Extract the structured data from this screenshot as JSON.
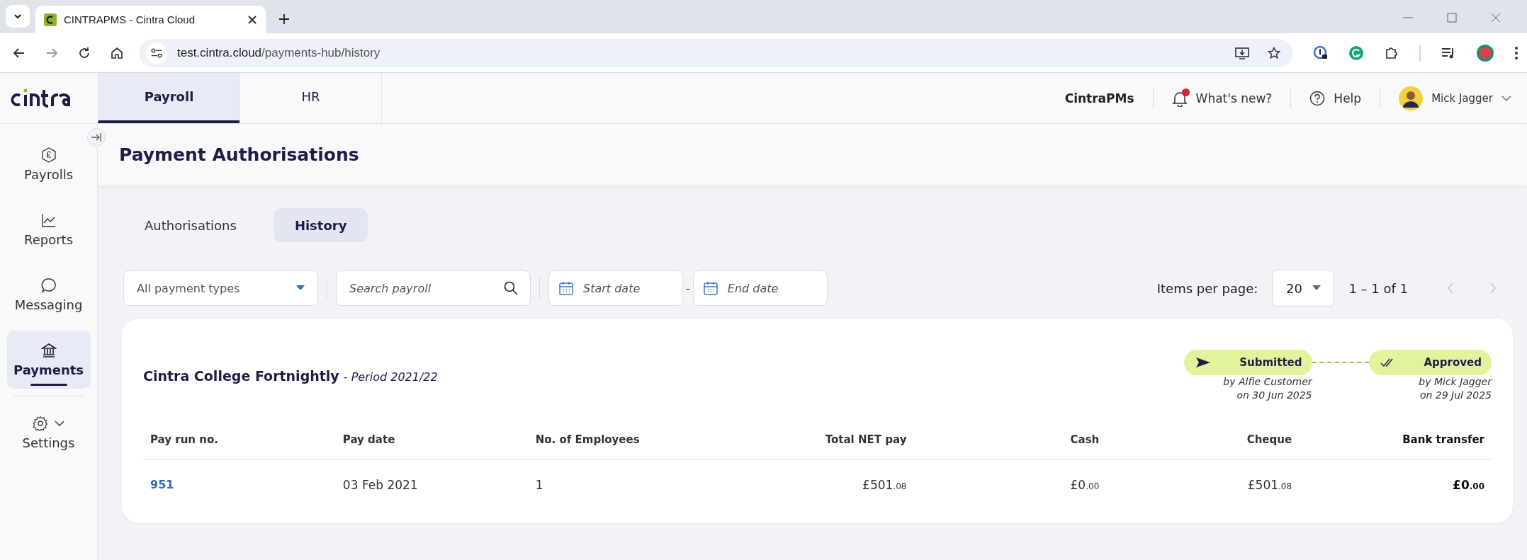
{
  "browser": {
    "tab_title": "CINTRAPMS - Cintra Cloud",
    "url_host": "test.cintra.cloud",
    "url_path": "/payments-hub/history"
  },
  "app_header": {
    "tabs": [
      {
        "label": "Payroll",
        "selected": true
      },
      {
        "label": "HR",
        "selected": false
      }
    ],
    "org": "CintraPMs",
    "whats_new": "What's new?",
    "whats_new_unread": true,
    "help": "Help",
    "user": "Mick Jagger"
  },
  "sidebar": {
    "items": [
      {
        "label": "Payrolls",
        "selected": false
      },
      {
        "label": "Reports",
        "selected": false
      },
      {
        "label": "Messaging",
        "selected": false
      },
      {
        "label": "Payments",
        "selected": true
      },
      {
        "label": "Settings",
        "selected": false,
        "kind": "expandable"
      }
    ]
  },
  "page": {
    "title": "Payment Authorisations",
    "tabs": [
      {
        "label": "Authorisations",
        "selected": false
      },
      {
        "label": "History",
        "selected": true
      }
    ],
    "filters": {
      "payment_type": "All payment types",
      "search_placeholder": "Search payroll",
      "start_placeholder": "Start date",
      "separator": "-",
      "end_placeholder": "End date"
    },
    "pagination": {
      "label": "Items per page:",
      "per_page": "20",
      "range": "1 – 1 of 1"
    },
    "cards": [
      {
        "name": "Cintra College Fortnightly",
        "period": "- Period 2021/22",
        "steps": [
          {
            "label": "Submitted",
            "by": "by Alfie Customer",
            "on": "on 30 Jun 2025"
          },
          {
            "label": "Approved",
            "by": "by Mick Jagger",
            "on": "on 29 Jul 2025"
          }
        ],
        "columns": [
          {
            "label": "Pay run no.",
            "bold": false
          },
          {
            "label": "Pay date",
            "bold": false
          },
          {
            "label": "No. of Employees",
            "bold": false
          },
          {
            "label": "Total NET pay",
            "bold": false
          },
          {
            "label": "Cash",
            "bold": false
          },
          {
            "label": "Cheque",
            "bold": false
          },
          {
            "label": "Bank transfer",
            "bold": true
          }
        ],
        "rows": [
          {
            "cells": [
              {
                "text": "951",
                "kind": "link"
              },
              {
                "text": "03 Feb 2021",
                "kind": "text"
              },
              {
                "text": "1",
                "kind": "text"
              },
              {
                "text": "£501",
                "pence": ".08",
                "kind": "money"
              },
              {
                "text": "£0",
                "pence": ".00",
                "kind": "money"
              },
              {
                "text": "£501",
                "pence": ".08",
                "kind": "money"
              },
              {
                "text": "£0",
                "pence": ".00",
                "kind": "money"
              }
            ]
          }
        ]
      }
    ]
  }
}
